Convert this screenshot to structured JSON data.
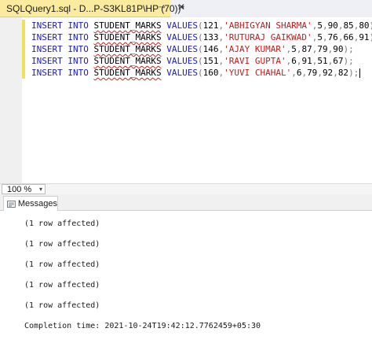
{
  "tab": {
    "title": "SQLQuery1.sql - D...P-S3KL81P\\HP (70))*",
    "pin_glyph": "⊸",
    "close_glyph": "✕"
  },
  "editor": {
    "keywords": {
      "insert": "INSERT",
      "into": "INTO",
      "values": "VALUES"
    },
    "table_name": "STUDENT_MARKS",
    "lines": [
      {
        "id": "121",
        "name": "'ABHIGYAN SHARMA'",
        "m1": "5",
        "m2": "90",
        "m3": "85",
        "m4": "80"
      },
      {
        "id": "133",
        "name": "'RUTURAJ GAIKWAD'",
        "m1": "5",
        "m2": "76",
        "m3": "66",
        "m4": "91"
      },
      {
        "id": "146",
        "name": "'AJAY KUMAR'",
        "m1": "5",
        "m2": "87",
        "m3": "79",
        "m4": "90"
      },
      {
        "id": "151",
        "name": "'RAVI GUPTA'",
        "m1": "6",
        "m2": "91",
        "m3": "51",
        "m4": "67"
      },
      {
        "id": "160",
        "name": "'YUVI CHAHAL'",
        "m1": "6",
        "m2": "79",
        "m3": "92",
        "m4": "82"
      }
    ]
  },
  "zoom": {
    "value": "100 %",
    "arrow_glyph": "▾"
  },
  "results": {
    "messages_tab_label": "Messages"
  },
  "messages": {
    "lines": [
      "(1 row affected)",
      "(1 row affected)",
      "(1 row affected)",
      "(1 row affected)",
      "(1 row affected)"
    ],
    "completion": "Completion time: 2021-10-24T19:42:12.7762459+05:30"
  },
  "colors": {
    "keyword": "#1a1acc",
    "string": "#c41a1a",
    "tab_active": "#fbeb9e",
    "change_bar": "#f1e05a"
  }
}
